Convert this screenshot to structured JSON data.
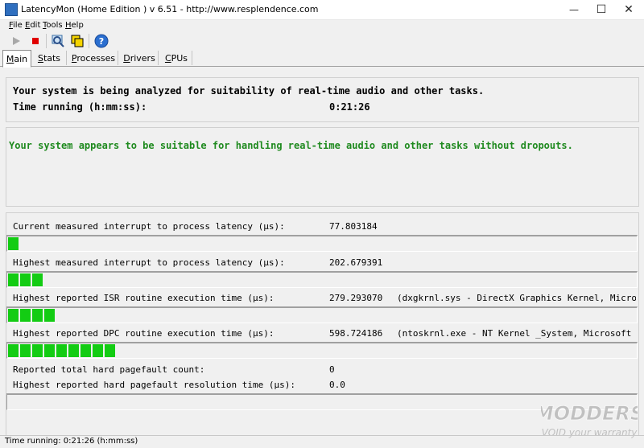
{
  "window": {
    "title": "LatencyMon  (Home Edition )  v 6.51 - http://www.resplendence.com",
    "minimize": "—",
    "maximize": "☐",
    "close": "✕"
  },
  "menu": [
    "File",
    "Edit",
    "Tools",
    "Help"
  ],
  "toolbar": {
    "play_icon": "play-icon",
    "stop_icon": "stop-icon",
    "search_icon": "search-icon",
    "copy_icon": "copy-icon",
    "help_icon": "help-icon",
    "help_glyph": "?"
  },
  "tabs": [
    "Main",
    "Stats",
    "Processes",
    "Drivers",
    "CPUs"
  ],
  "analysis": {
    "heading": "Your system is being analyzed for suitability of real-time audio and other tasks.",
    "time_label": "Time running (h:mm:ss):",
    "time_value": "0:21:26"
  },
  "verdict": "Your system appears to be suitable for handling real-time audio and other tasks without dropouts.",
  "metrics": [
    {
      "label": "Current measured interrupt to process latency (µs):",
      "value": "77.803184",
      "extra": "",
      "bar_segments": 1
    },
    {
      "label": "Highest measured interrupt to process latency (µs):",
      "value": "202.679391",
      "extra": "",
      "bar_segments": 3
    },
    {
      "label": "Highest reported ISR routine execution time (µs):",
      "value": "279.293070",
      "extra": "(dxgkrnl.sys - DirectX Graphics Kernel, Micro",
      "bar_segments": 4
    },
    {
      "label": "Highest reported DPC routine execution time (µs):",
      "value": "598.724186",
      "extra": "(ntoskrnl.exe - NT Kernel _System, Microsoft",
      "bar_segments": 9
    }
  ],
  "pagefault": {
    "count_label": "Reported total hard pagefault count:",
    "count_value": "0",
    "time_label": "Highest reported hard pagefault resolution time (µs):",
    "time_value": "0.0",
    "bar_segments": 0
  },
  "status_bar": "Time running: 0:21:26  (h:mm:ss)",
  "watermark": {
    "line1": "MODDERS",
    "line2": "VOID your warranty"
  },
  "colors": {
    "bar": "#13cc13",
    "verdict": "#1f8a1f",
    "stop": "#e00000"
  }
}
